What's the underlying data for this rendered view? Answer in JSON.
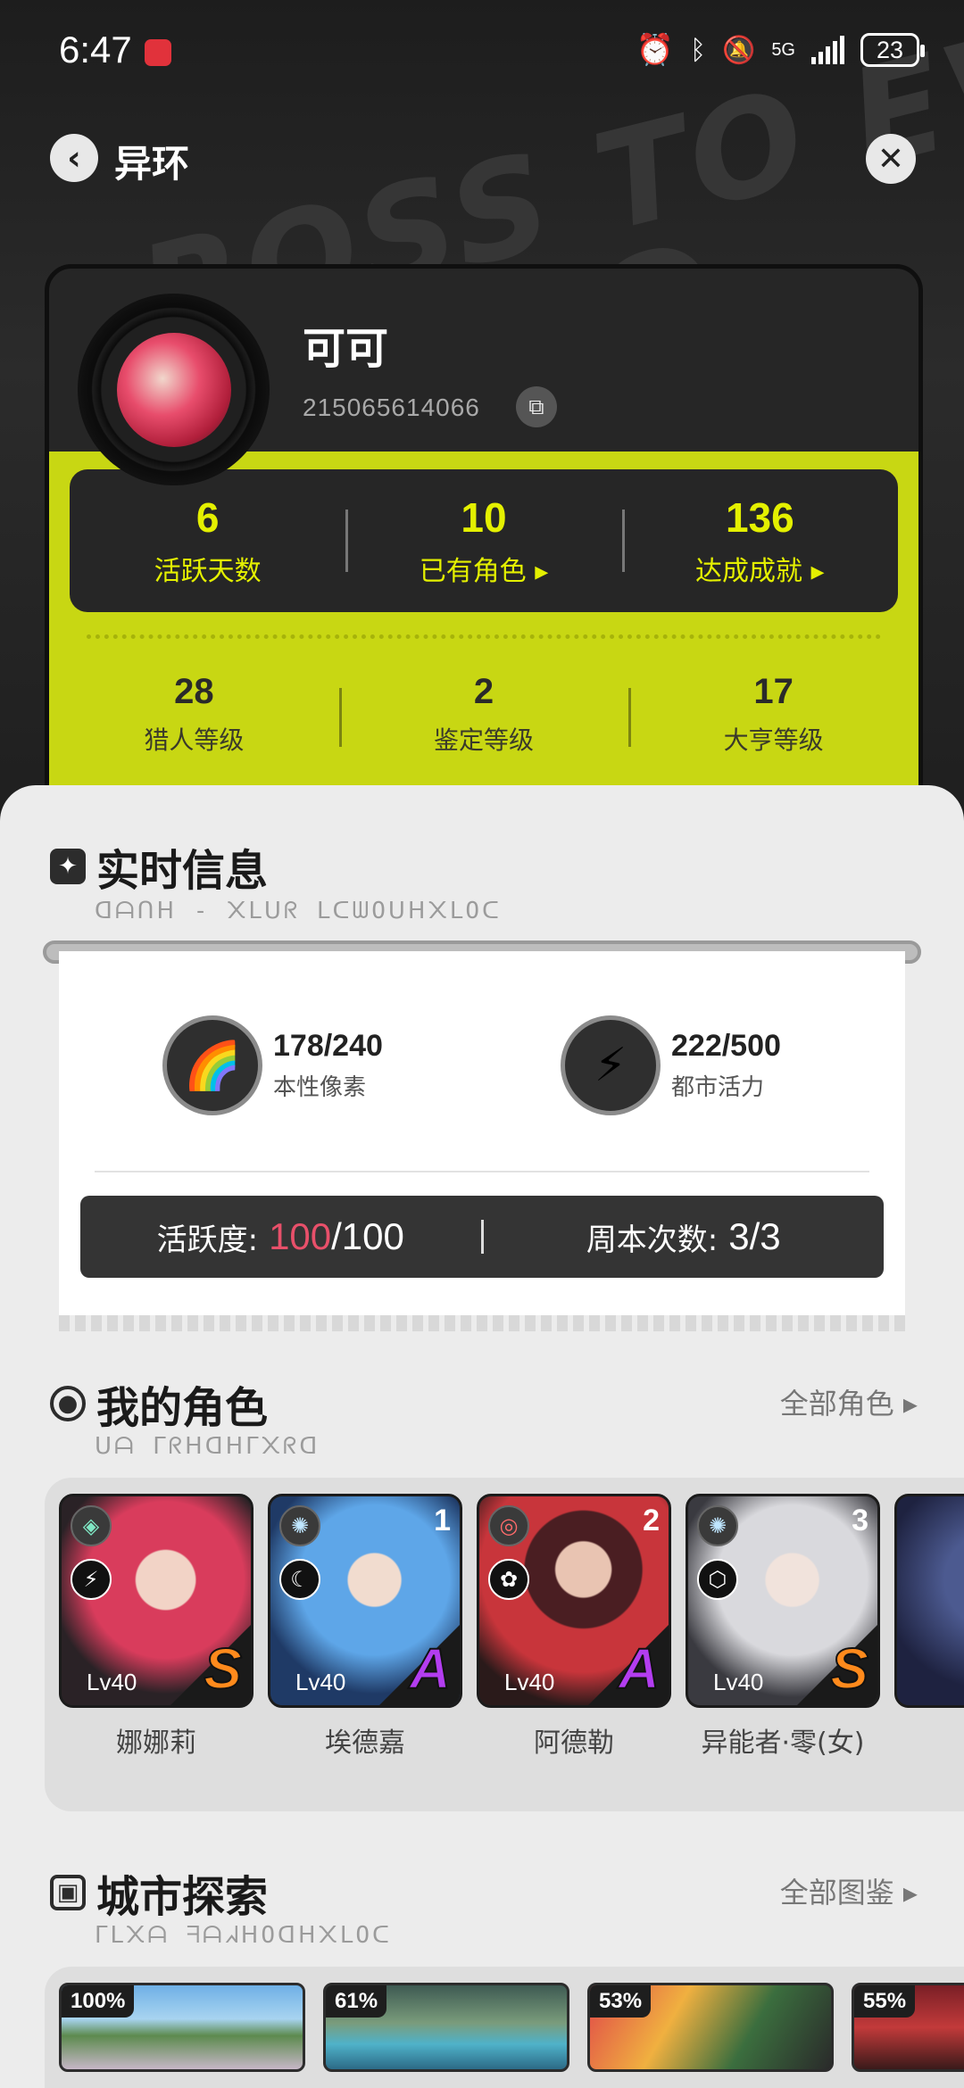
{
  "status_bar": {
    "time": "6:47",
    "network": "5G",
    "battery": "23"
  },
  "nav": {
    "title": "异环"
  },
  "profile": {
    "name": "可可",
    "id": "215065614066",
    "primary_stats": [
      {
        "value": "6",
        "label": "活跃天数"
      },
      {
        "value": "10",
        "label": "已有角色 ▸"
      },
      {
        "value": "136",
        "label": "达成成就 ▸"
      }
    ],
    "secondary_stats": [
      {
        "value": "28",
        "label": "猎人等级"
      },
      {
        "value": "2",
        "label": "鉴定等级"
      },
      {
        "value": "17",
        "label": "大亨等级"
      }
    ]
  },
  "realtime": {
    "title": "实时信息",
    "subtitle": "ᗡᗩᑎᕼ - ᙭ᒪᑌᖇ ᒪᑕᗯOᑌᕼ᙭ᒪOᑕ",
    "resources": [
      {
        "value": "178/240",
        "label": "本性像素",
        "icon": "pixel-card-icon"
      },
      {
        "value": "222/500",
        "label": "都市活力",
        "icon": "lightning-orb-icon"
      }
    ],
    "activity_label": "活跃度:",
    "activity_current": "100",
    "activity_max": "/100",
    "weekly_label": "周本次数:",
    "weekly_value": "3/3"
  },
  "characters": {
    "title": "我的角色",
    "subtitle": "ᑌᗩ ᒥᖇᕼᗡᕼᒥ᙭ᖇᗡ",
    "link": "全部角色 ▸",
    "items": [
      {
        "name": "娜娜莉",
        "level": "Lv40",
        "grade": "S",
        "rank": "",
        "color1": "#d93c5c",
        "color2": "#2a2226"
      },
      {
        "name": "埃德嘉",
        "level": "Lv40",
        "grade": "A",
        "rank": "1",
        "color1": "#5ea6e8",
        "color2": "#1f3a66"
      },
      {
        "name": "阿德勒",
        "level": "Lv40",
        "grade": "A",
        "rank": "2",
        "color1": "#c8353b",
        "color2": "#4a1e22"
      },
      {
        "name": "异能者·零(女)",
        "level": "Lv40",
        "grade": "S",
        "rank": "3",
        "color1": "#d9d9dd",
        "color2": "#3a3a40"
      }
    ]
  },
  "city": {
    "title": "城市探索",
    "subtitle": "ᒥᒪ᙭ᗩ ᖷᗩᖽᕼOᗡᕼ᙭ᒪOᑕ",
    "link": "全部图鉴 ▸",
    "items": [
      {
        "percent": "100%"
      },
      {
        "percent": "61%"
      },
      {
        "percent": "53%"
      },
      {
        "percent": "55%"
      }
    ]
  }
}
